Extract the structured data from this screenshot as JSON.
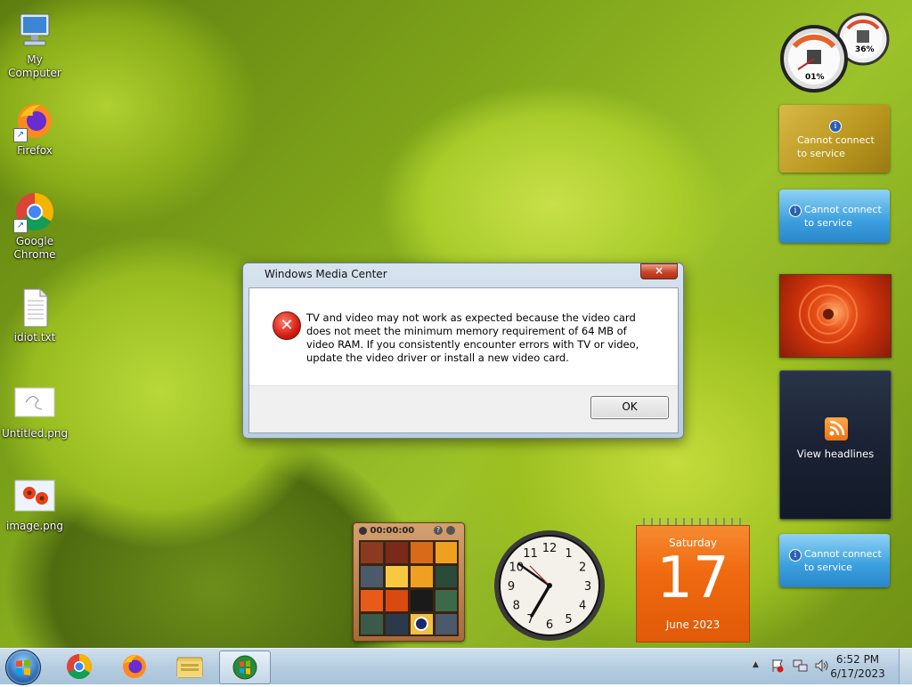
{
  "desktop_icons": [
    {
      "id": "my-computer",
      "label": "My Computer",
      "icon": "computer-icon",
      "shortcut": false
    },
    {
      "id": "firefox",
      "label": "Firefox",
      "icon": "firefox-icon",
      "shortcut": true
    },
    {
      "id": "chrome",
      "label": "Google Chrome",
      "icon": "chrome-icon",
      "shortcut": true
    },
    {
      "id": "idiot-txt",
      "label": "idiot.txt",
      "icon": "text-file-icon",
      "shortcut": false
    },
    {
      "id": "untitled-png",
      "label": "Untitled.png",
      "icon": "image-file-icon",
      "shortcut": false
    },
    {
      "id": "image-png",
      "label": "image.png",
      "icon": "flower-image-icon",
      "shortcut": false
    }
  ],
  "gadgets": {
    "cpu_meter": {
      "cpu": "01%",
      "memory": "36%"
    },
    "currency_gadget": {
      "message": "Cannot connect to service"
    },
    "weather_gadget": {
      "message": "Cannot connect to service"
    },
    "stocks_gadget": {
      "message": "Cannot connect to service"
    },
    "feed_gadget": {
      "label": "View headlines"
    },
    "puzzle_gadget": {
      "timer": "00:00:00"
    },
    "clock_gadget": {
      "numbers": [
        "12",
        "1",
        "2",
        "3",
        "4",
        "5",
        "6",
        "7",
        "8",
        "9",
        "10",
        "11"
      ]
    },
    "calendar_gadget": {
      "weekday": "Saturday",
      "day": "17",
      "month_year": "June 2023"
    }
  },
  "dialog": {
    "title": "Windows Media Center",
    "close_label": "×",
    "message": "TV and video may not work as expected because the video card does not meet the minimum memory requirement of 64 MB of video RAM. If you consistently encounter errors with TV or video, update the video driver or install a new video card.",
    "ok_label": "OK"
  },
  "taskbar": {
    "pinned": [
      "chrome-icon",
      "firefox-icon",
      "explorer-icon",
      "media-center-icon"
    ],
    "tray_arrow": "▲",
    "time": "6:52 PM",
    "date": "6/17/2023"
  },
  "colors": {
    "calendar_orange": "#f06a10",
    "dialog_frame": "#c4d5e4",
    "error_red": "#d41e12",
    "service_blue": "#3aa2e0",
    "service_gold": "#c8a52a"
  }
}
